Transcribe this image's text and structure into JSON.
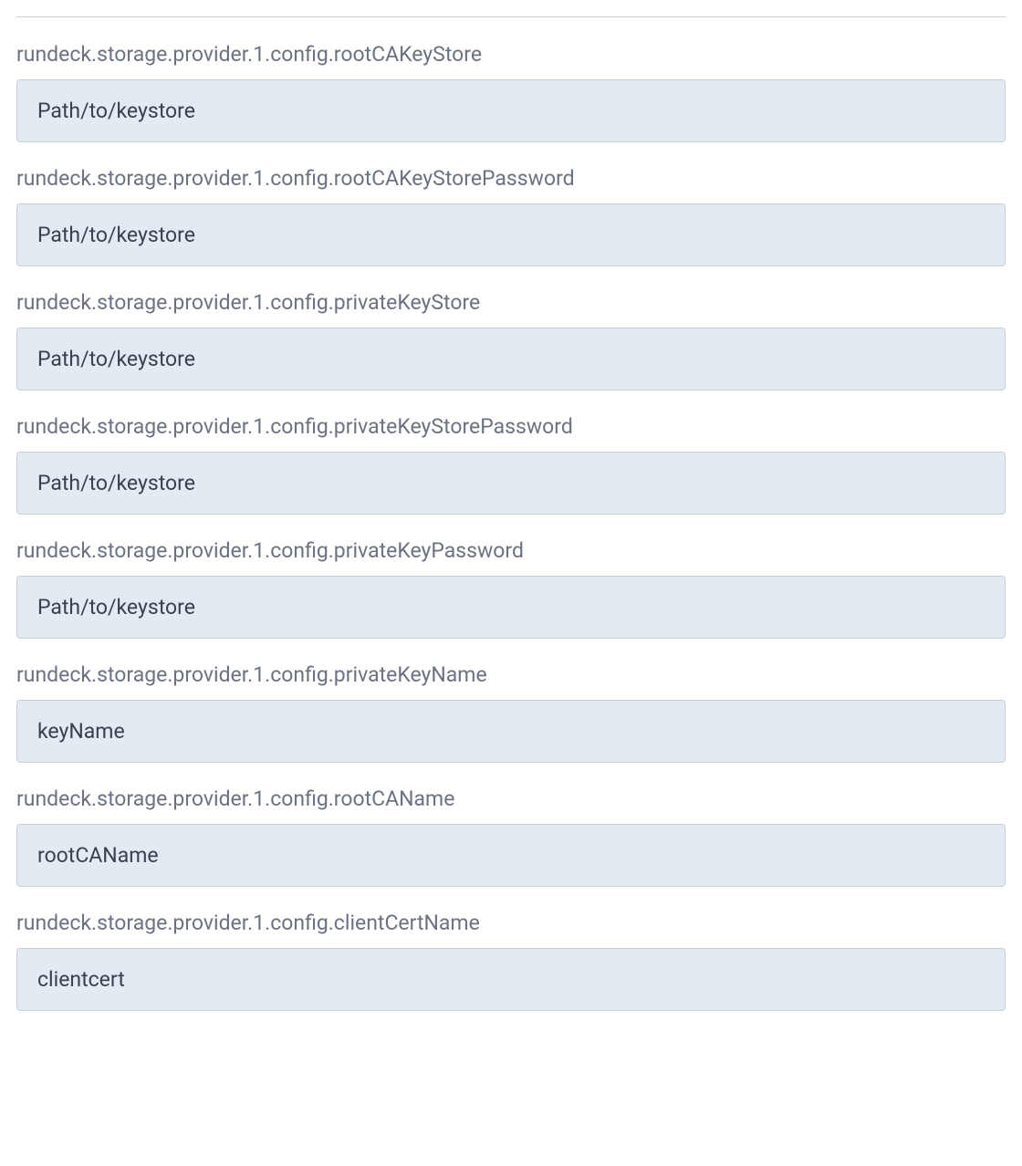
{
  "fields": [
    {
      "label": "rundeck.storage.provider.1.config.rootCAKeyStore",
      "value": "Path/to/keystore"
    },
    {
      "label": "rundeck.storage.provider.1.config.rootCAKeyStorePassword",
      "value": "Path/to/keystore"
    },
    {
      "label": "rundeck.storage.provider.1.config.privateKeyStore",
      "value": "Path/to/keystore"
    },
    {
      "label": "rundeck.storage.provider.1.config.privateKeyStorePassword",
      "value": "Path/to/keystore"
    },
    {
      "label": "rundeck.storage.provider.1.config.privateKeyPassword",
      "value": "Path/to/keystore"
    },
    {
      "label": "rundeck.storage.provider.1.config.privateKeyName",
      "value": "keyName"
    },
    {
      "label": "rundeck.storage.provider.1.config.rootCAName",
      "value": "rootCAName"
    },
    {
      "label": "rundeck.storage.provider.1.config.clientCertName",
      "value": "clientcert"
    }
  ]
}
